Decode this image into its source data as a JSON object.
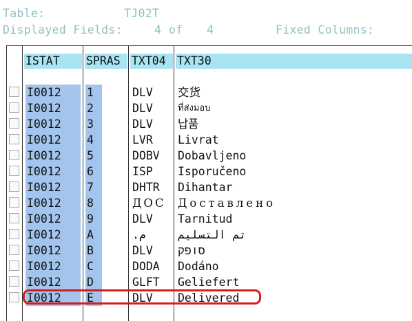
{
  "header": {
    "table_label": "Table:",
    "table_value": "TJ02T",
    "fields_label": "Displayed Fields:",
    "fields_shown": "4",
    "fields_of": "of",
    "fields_total": "4",
    "fixed_columns_label": "Fixed Columns:"
  },
  "columns": [
    "ISTAT",
    "SPRAS",
    "TXT04",
    "TXT30"
  ],
  "rows": [
    {
      "istat": "I0012",
      "spras": "1",
      "txt04": "DLV",
      "txt30": "交货"
    },
    {
      "istat": "I0012",
      "spras": "2",
      "txt04": "DLV",
      "txt30": "ที่ส่งมอบ"
    },
    {
      "istat": "I0012",
      "spras": "3",
      "txt04": "DLV",
      "txt30": "납품"
    },
    {
      "istat": "I0012",
      "spras": "4",
      "txt04": "LVR",
      "txt30": "Livrat"
    },
    {
      "istat": "I0012",
      "spras": "5",
      "txt04": "DOBV",
      "txt30": "Dobavljeno"
    },
    {
      "istat": "I0012",
      "spras": "6",
      "txt04": "ISP",
      "txt30": "Isporučeno"
    },
    {
      "istat": "I0012",
      "spras": "7",
      "txt04": "DHTR",
      "txt30": "Dihantar"
    },
    {
      "istat": "I0012",
      "spras": "8",
      "txt04": "ДОС",
      "txt30": "Доставлено"
    },
    {
      "istat": "I0012",
      "spras": "9",
      "txt04": "DLV",
      "txt30": "Tarnitud"
    },
    {
      "istat": "I0012",
      "spras": "A",
      "txt04": "م.",
      "txt30": "تم التسليم"
    },
    {
      "istat": "I0012",
      "spras": "B",
      "txt04": "DLV",
      "txt30": "סופק"
    },
    {
      "istat": "I0012",
      "spras": "C",
      "txt04": "DODA",
      "txt30": "Dodáno"
    },
    {
      "istat": "I0012",
      "spras": "D",
      "txt04": "GLFT",
      "txt30": "Geliefert"
    },
    {
      "istat": "I0012",
      "spras": "E",
      "txt04": "DLV",
      "txt30": "Delivered"
    }
  ],
  "highlight_color": "#d51b1b",
  "selection_color": "#a3c4ec",
  "header_color": "#a8e4f2"
}
